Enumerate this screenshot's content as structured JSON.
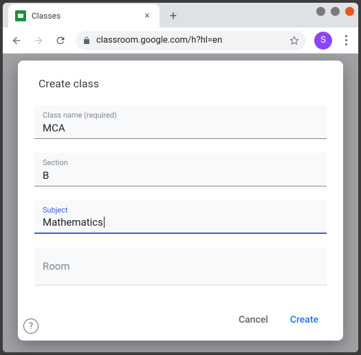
{
  "window": {
    "tab_title": "Classes",
    "url": "classroom.google.com/h?hl=en",
    "profile_initial": "S"
  },
  "dialog": {
    "title": "Create class",
    "fields": {
      "class_name": {
        "label": "Class name (required)",
        "value": "MCA"
      },
      "section": {
        "label": "Section",
        "value": "B"
      },
      "subject": {
        "label": "Subject",
        "value": "Mathematics"
      },
      "room": {
        "placeholder": "Room",
        "value": ""
      }
    },
    "actions": {
      "cancel": "Cancel",
      "create": "Create"
    }
  },
  "help_tooltip": "?"
}
